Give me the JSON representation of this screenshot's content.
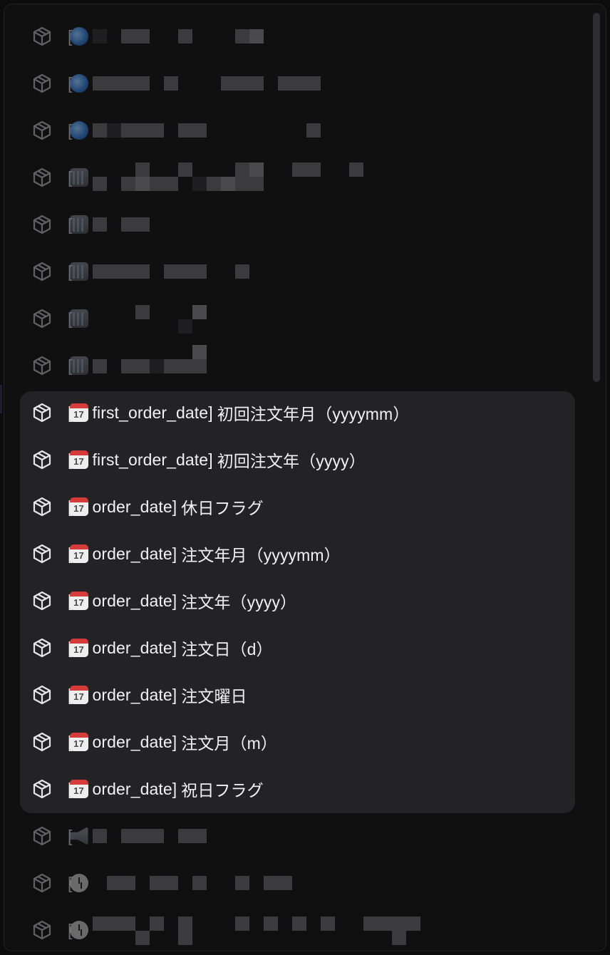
{
  "list": {
    "hidden_items": [
      {
        "emoji": "globe-emoji"
      },
      {
        "emoji": "globe-emoji"
      },
      {
        "emoji": "globe-emoji"
      },
      {
        "emoji": "building-emoji"
      },
      {
        "emoji": "building-emoji"
      },
      {
        "emoji": "building-emoji"
      },
      {
        "emoji": "building-emoji"
      },
      {
        "emoji": "building-emoji"
      }
    ],
    "visible_items": [
      {
        "bracket": "[",
        "column": "first_order_date",
        "close": "]",
        "title": "初回注文年月（yyyymm）"
      },
      {
        "bracket": "[",
        "column": "first_order_date",
        "close": "]",
        "title": "初回注文年（yyyy）"
      },
      {
        "bracket": "[",
        "column": "order_date",
        "close": "]",
        "title": "休日フラグ"
      },
      {
        "bracket": "[",
        "column": "order_date",
        "close": "]",
        "title": "注文年月（yyyymm）"
      },
      {
        "bracket": "[",
        "column": "order_date",
        "close": "]",
        "title": "注文年（yyyy）"
      },
      {
        "bracket": "[",
        "column": "order_date",
        "close": "]",
        "title": "注文日（d）"
      },
      {
        "bracket": "[",
        "column": "order_date",
        "close": "]",
        "title": "注文曜日"
      },
      {
        "bracket": "[",
        "column": "order_date",
        "close": "]",
        "title": "注文月（m）"
      },
      {
        "bracket": "[",
        "column": "order_date",
        "close": "]",
        "title": "祝日フラグ"
      }
    ],
    "hidden_items_bottom": [
      {
        "emoji": "megaphone-emoji"
      },
      {
        "emoji": "clock-emoji"
      },
      {
        "emoji": "clock-emoji"
      }
    ],
    "bracket": "[",
    "item_icon": "cube-icon",
    "calendar_emoji": "calendar-emoji",
    "colors": {
      "background": "#101011",
      "highlight": "#232325",
      "text": "#f2f2f4",
      "calendar_red": "#d63b3b"
    }
  }
}
